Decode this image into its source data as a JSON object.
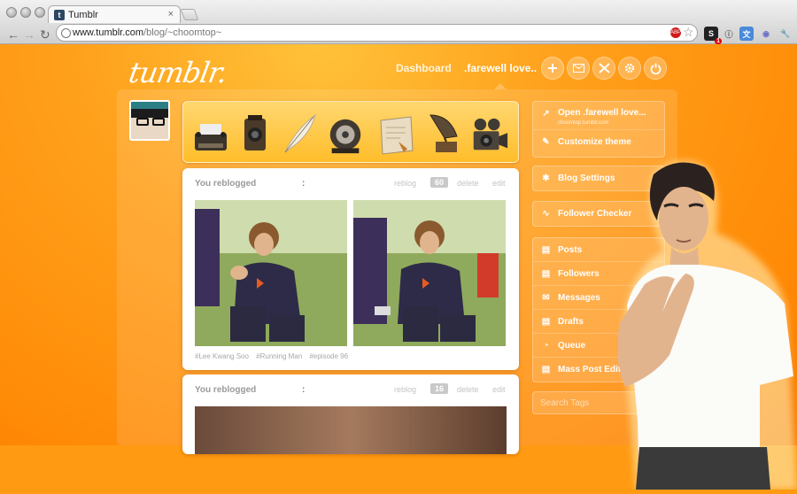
{
  "browser": {
    "tab_title": "Tumblr",
    "tab_favicon": "t",
    "tab_close": "×",
    "url_domain": "www.tumblr.com",
    "url_path": "/blog/~choomtop~",
    "adblock_label": "ABP",
    "ext_badge": "1"
  },
  "header": {
    "logo": "tumblr.",
    "dashboard_label": "Dashboard",
    "blog_label": ".farewell love..",
    "icons": [
      "new-post-icon",
      "mail-icon",
      "tumblr-x-icon",
      "gear-icon",
      "power-icon"
    ]
  },
  "post_types": [
    "typewriter-icon",
    "camera-icon",
    "quill-icon",
    "phonograph-horn-icon",
    "scroll-icon",
    "gramophone-icon",
    "video-camera-icon"
  ],
  "posts": [
    {
      "head": "You reblogged",
      "colon": ":",
      "reblog": "reblog",
      "notes": "60",
      "delete": "delete",
      "edit": "edit",
      "tags": [
        "#Lee Kwang Soo",
        "#Running Man",
        "#episode 96"
      ]
    },
    {
      "head": "You reblogged",
      "colon": ":",
      "reblog": "reblog",
      "notes": "16",
      "delete": "delete",
      "edit": "edit"
    }
  ],
  "sidebar": {
    "open_blog": "Open .farewell love...",
    "open_blog_sub": "choomtop.tumblr.com",
    "customize": "Customize theme",
    "blog_settings": "Blog Settings",
    "follower_checker": "Follower Checker",
    "menu": [
      "Posts",
      "Followers",
      "Messages",
      "Drafts",
      "Queue",
      "Mass Post Editor"
    ],
    "search_placeholder": "Search Tags"
  },
  "colors": {
    "accent": "#ff9a12",
    "chrome": "#d6d6d6"
  }
}
